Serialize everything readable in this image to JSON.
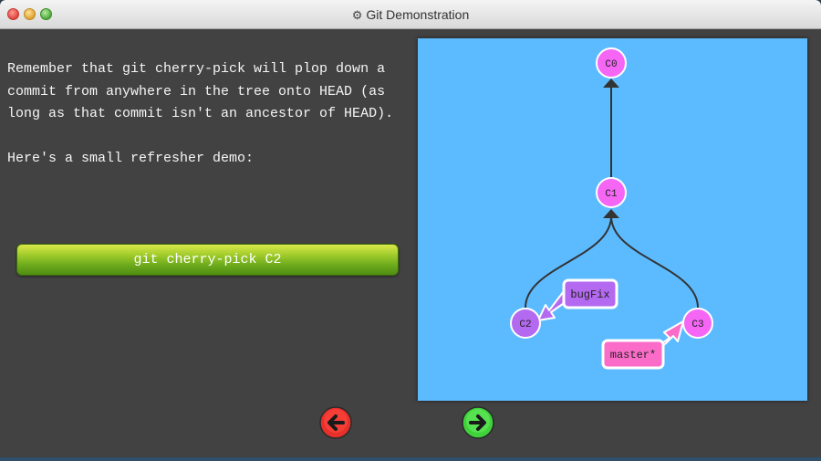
{
  "window": {
    "title": "Git Demonstration",
    "title_icon": "gear-icon"
  },
  "instructions": {
    "paragraph1": "Remember that git cherry-pick will plop down a commit from anywhere in the tree onto HEAD (as long as that commit isn't an ancestor of HEAD).",
    "paragraph2": "Here's a small refresher demo:"
  },
  "command_button": {
    "label": "git cherry-pick C2"
  },
  "tree": {
    "commits": [
      "C0",
      "C1",
      "C2",
      "C3"
    ],
    "branches": [
      "bugFix",
      "master*"
    ]
  },
  "navigation": {
    "prev_icon": "arrow-left-icon",
    "next_icon": "arrow-right-icon"
  },
  "colors": {
    "canvas_bg": "#5cbbff",
    "commit_main": "#f566f5",
    "commit_bugfix": "#b46af0",
    "branch_bugfix": "#b46af0",
    "branch_master": "#fb6cc9",
    "prev_button": "#e8302a",
    "next_button": "#3fd23a",
    "command_button": "#7cbf21"
  }
}
